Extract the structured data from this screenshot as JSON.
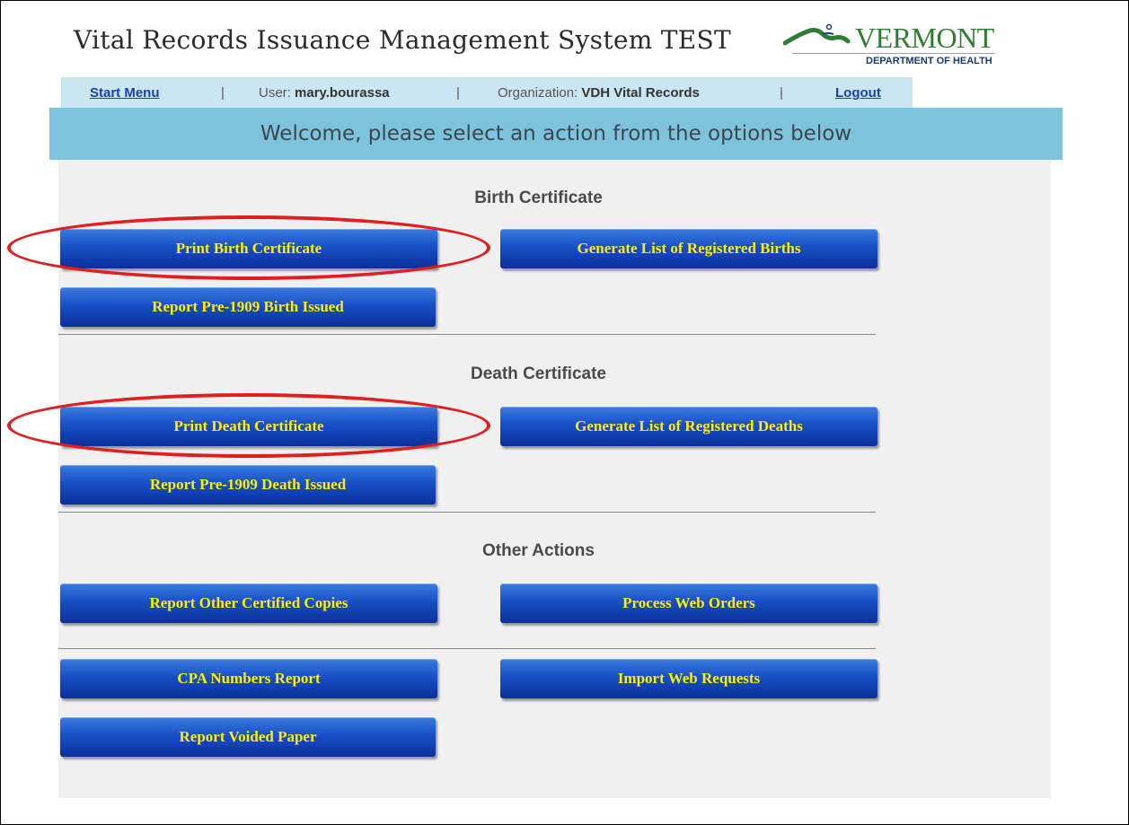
{
  "header": {
    "title": "Vital Records Issuance Management System TEST",
    "logo": {
      "name": "VERMONT",
      "subtitle": "DEPARTMENT OF HEALTH",
      "color": "#2e7d32"
    }
  },
  "navbar": {
    "start_menu": "Start Menu",
    "separator": "|",
    "user_label": "User:",
    "user_value": "mary.bourassa",
    "org_label": "Organization:",
    "org_value": "VDH Vital Records",
    "logout": "Logout"
  },
  "banner": {
    "text": "Welcome, please select an action from the options below"
  },
  "sections": {
    "birth": {
      "title": "Birth Certificate",
      "print": "Print Birth Certificate",
      "generate": "Generate List of Registered Births",
      "report_pre1909": "Report Pre-1909 Birth Issued"
    },
    "death": {
      "title": "Death Certificate",
      "print": "Print Death Certificate",
      "generate": "Generate List of Registered Deaths",
      "report_pre1909": "Report Pre-1909 Death Issued"
    },
    "other": {
      "title": "Other Actions",
      "report_other": "Report Other Certified Copies",
      "process_web": "Process Web Orders",
      "cpa_report": "CPA Numbers Report",
      "import_web": "Import Web Requests",
      "report_voided": "Report Voided Paper"
    }
  },
  "colors": {
    "button_text": "#ffee00",
    "button_bg": "#1850c6",
    "banner_bg": "#7ec3dc",
    "navbar_bg": "#c9e6f2",
    "highlight": "#e02020"
  }
}
